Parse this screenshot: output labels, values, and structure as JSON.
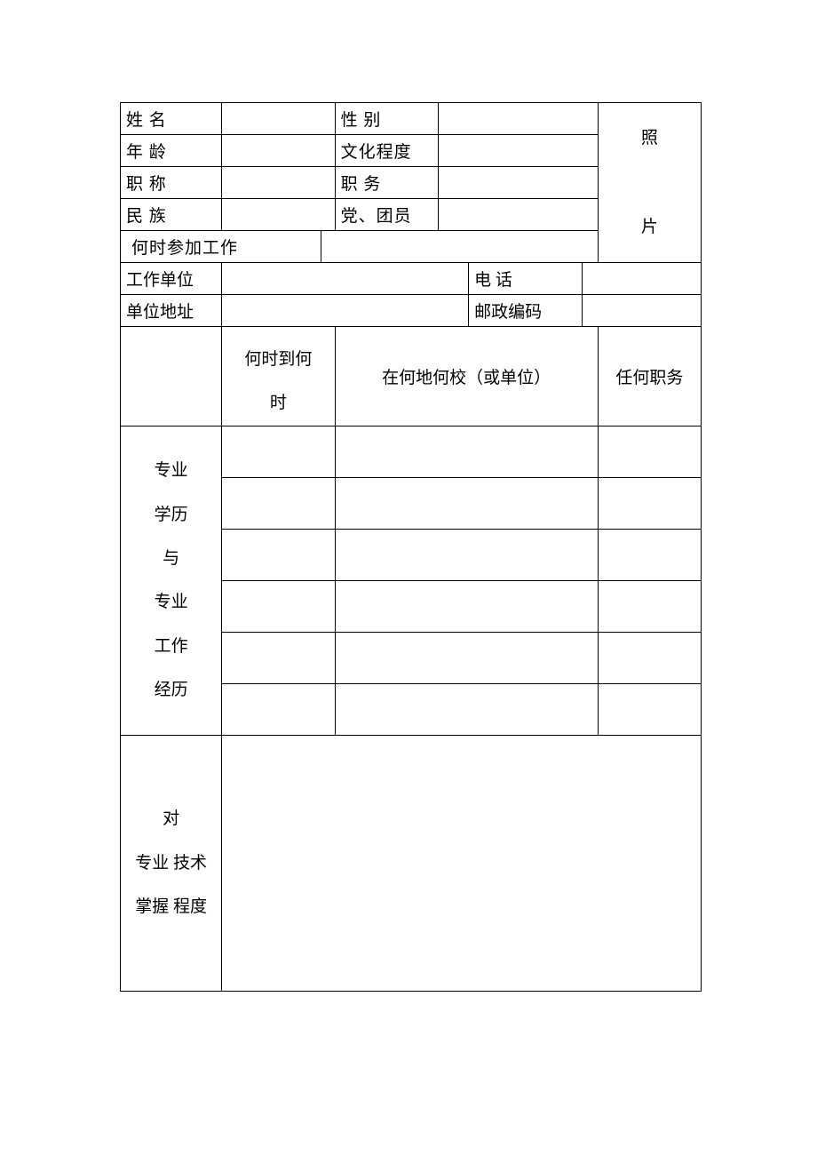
{
  "labels": {
    "name": "姓 名",
    "gender": "性 别",
    "age": "年 龄",
    "education": "文化程度",
    "title": "职 称",
    "position": "职 务",
    "ethnicity": "民 族",
    "party": "党、团员",
    "workStart": "何时参加工作",
    "workUnit": "工作单位",
    "phone": "电 话",
    "unitAddress": "单位地址",
    "postcode": "邮政编码",
    "photo1": "照",
    "photo2": "片",
    "period": "何时到何",
    "periodLine2": "时",
    "where": "在何地何校（或单位）",
    "heldPosition": "任何职务",
    "historyHeader1": "专业",
    "historyHeader2": "学历",
    "historyHeader3": "与",
    "historyHeader4": "专业",
    "historyHeader5": "工作",
    "historyHeader6": "经历",
    "mastery1": "对",
    "mastery2": "专业 技术",
    "mastery3": "掌握 程度"
  },
  "values": {
    "name": "",
    "gender": "",
    "age": "",
    "education": "",
    "title": "",
    "position": "",
    "ethnicity": "",
    "party": "",
    "workStart": "",
    "workUnit": "",
    "phone": "",
    "unitAddress": "",
    "postcode": ""
  }
}
